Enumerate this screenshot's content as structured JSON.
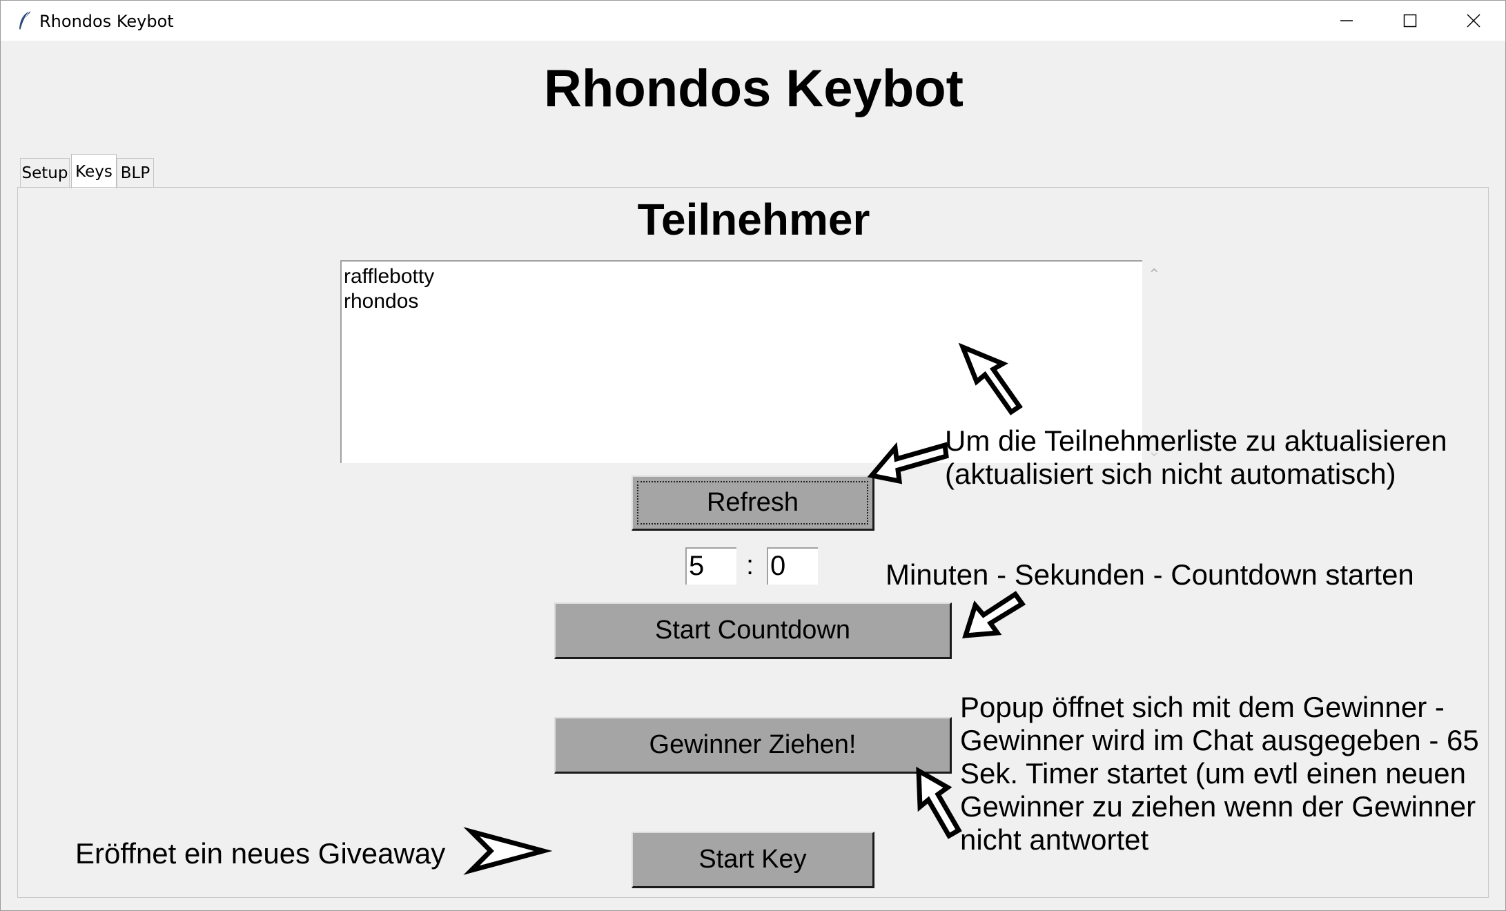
{
  "window": {
    "title": "Rhondos Keybot",
    "controls": {
      "minimize": "minimize-icon",
      "maximize": "maximize-icon",
      "close": "close-icon"
    }
  },
  "app": {
    "heading": "Rhondos Keybot"
  },
  "tabs": [
    {
      "label": "Setup",
      "active": false
    },
    {
      "label": "Keys",
      "active": true
    },
    {
      "label": "BLP",
      "active": false
    }
  ],
  "keys_tab": {
    "section_title": "Teilnehmer",
    "participants": [
      "rafflebotty",
      "rhondos"
    ],
    "refresh_label": "Refresh",
    "minutes_value": "5",
    "time_separator": ":",
    "seconds_value": "0",
    "start_countdown_label": "Start Countdown",
    "draw_winner_label": "Gewinner Ziehen!",
    "start_key_label": "Start Key"
  },
  "annotations": {
    "refresh_note": [
      "Um die Teilnehmerliste zu aktualisieren",
      "(aktualisiert sich nicht automatisch)"
    ],
    "countdown_note": "Minuten - Sekunden - Countdown starten",
    "winner_note": [
      "Popup öffnet sich mit dem Gewinner -",
      "Gewinner wird im Chat ausgegeben - 65",
      "Sek. Timer startet (um evtl einen neuen",
      "Gewinner zu ziehen wenn der Gewinner",
      "nicht antwortet"
    ],
    "giveaway_note": "Eröffnet ein neues Giveaway"
  },
  "colors": {
    "button_face": "#a5a5a5",
    "window_bg": "#f0f0f0",
    "titlebar_bg": "#ffffff"
  }
}
